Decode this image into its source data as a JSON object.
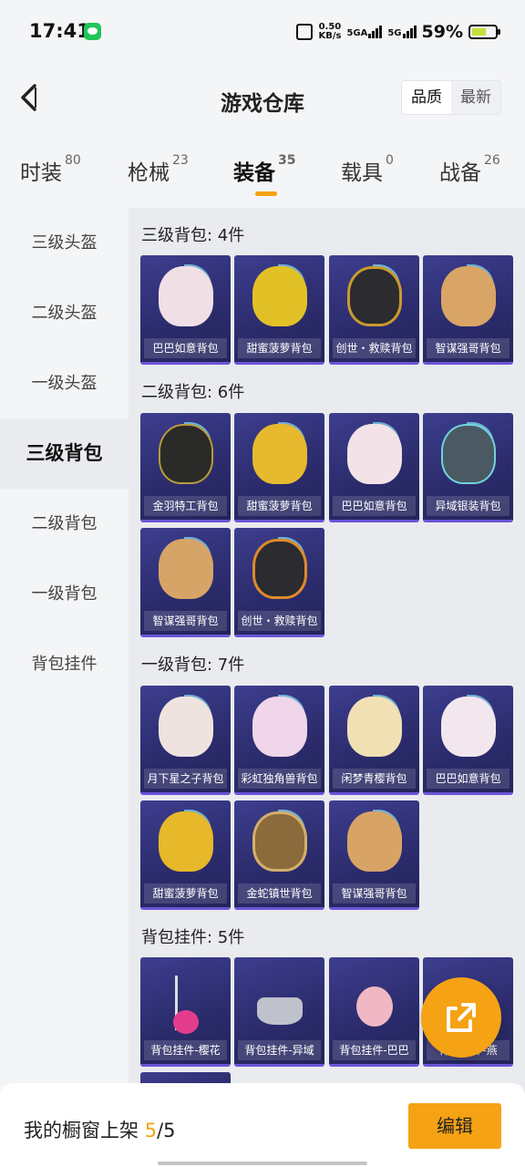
{
  "status_bar": {
    "time": "17:41",
    "speed_value": "0.50",
    "speed_unit": "KB/s",
    "net1": "5GA",
    "net2": "5G",
    "battery_pct": "59%"
  },
  "header": {
    "title": "游戏仓库",
    "sort_quality": "品质",
    "sort_latest": "最新"
  },
  "tabs": [
    {
      "label": "时装",
      "count": "80"
    },
    {
      "label": "枪械",
      "count": "23"
    },
    {
      "label": "装备",
      "count": "35"
    },
    {
      "label": "载具",
      "count": "0"
    },
    {
      "label": "战备",
      "count": "26"
    }
  ],
  "sidebar": [
    {
      "label": "三级头盔"
    },
    {
      "label": "二级头盔"
    },
    {
      "label": "一级头盔"
    },
    {
      "label": "三级背包"
    },
    {
      "label": "二级背包"
    },
    {
      "label": "一级背包"
    },
    {
      "label": "背包挂件"
    }
  ],
  "sections": [
    {
      "title": "三级背包: 4件",
      "items": [
        "巴巴如意背包",
        "甜蜜菠萝背包",
        "创世・救赎背包",
        "智谋强哥背包"
      ]
    },
    {
      "title": "二级背包: 6件",
      "items": [
        "金羽特工背包",
        "甜蜜菠萝背包",
        "巴巴如意背包",
        "异域银装背包",
        "智谋强哥背包",
        "创世・救赎背包"
      ]
    },
    {
      "title": "一级背包: 7件",
      "items": [
        "月下星之子背包",
        "彩虹独角兽背包",
        "闲梦青樱背包",
        "巴巴如意背包",
        "甜蜜菠萝背包",
        "金蛇镇世背包",
        "智谋强哥背包"
      ]
    },
    {
      "title": "背包挂件: 5件",
      "items": [
        "背包挂件-樱花",
        "背包挂件-异域",
        "背包挂件-巴巴",
        "背包挂件-燕",
        ""
      ]
    }
  ],
  "bottom": {
    "shop_prefix": "我的橱窗上架",
    "shop_count": "5",
    "shop_total": "/5",
    "edit_label": "编辑"
  },
  "colors": {
    "accent": "#f5a214",
    "card_bg": "#2f2f72"
  },
  "icons": {
    "back": "back-chevron-icon",
    "share": "share-export-icon"
  }
}
